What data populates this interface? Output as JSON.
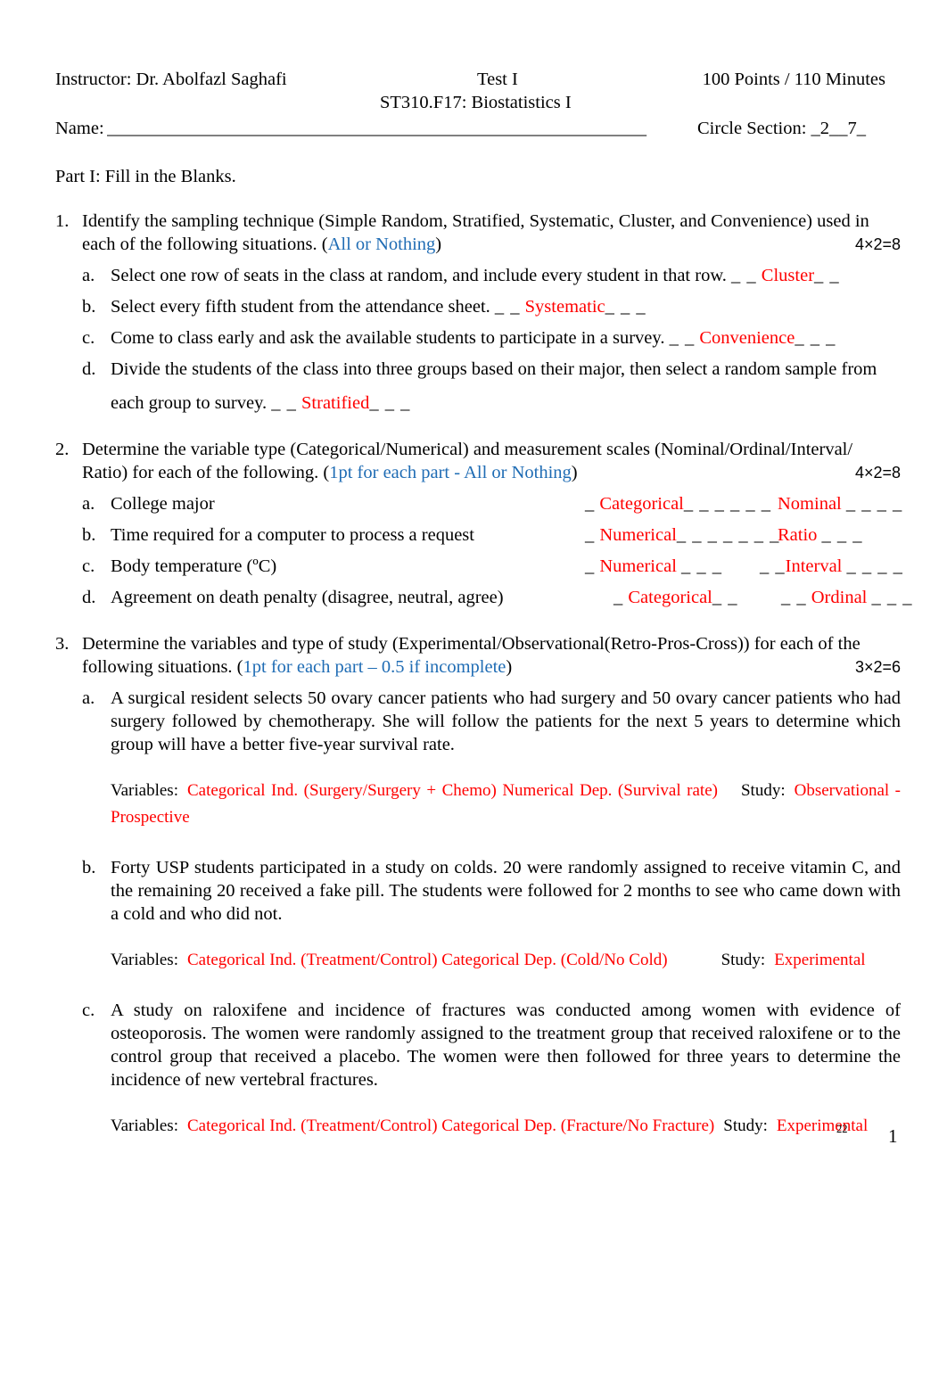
{
  "header": {
    "instructor": "Instructor: Dr. Abolfazl Saghafi",
    "test": "Test I",
    "points": "100 Points / 110 Minutes",
    "course": "ST310.F17: Biostatistics I",
    "name_label": "Name:",
    "name_line": "______________________________________________________________",
    "section": "Circle Section: _2__7_"
  },
  "part": {
    "title": "Part I: Fill in the Blanks."
  },
  "questions": [
    {
      "number": "1.",
      "stem_a": "Identify the sampling technique (Simple Random, Stratified, Systematic, Cluster, and Convenience) used in",
      "stem_b": "each of the following situations. (",
      "stem_blue": "All or Nothing",
      "stem_c": ")",
      "points": "4×2=8",
      "items": [
        {
          "label": "a.",
          "text": "Select one row of seats in the class at random, and include every student in that row.",
          "pre_blank": "_ _",
          "answer": "Cluster",
          "post_blank": "_ _"
        },
        {
          "label": "b.",
          "text": "Select every fifth student from the attendance sheet.",
          "pre_blank": "_ _",
          "answer": "Systematic",
          "post_blank": "_ _ _"
        },
        {
          "label": "c.",
          "text": "Come to class early and ask the available students to participate in a survey.",
          "pre_blank": "_ _",
          "answer": "Convenience",
          "post_blank": "_ _ _"
        },
        {
          "label": "d.",
          "text_line1": "Divide the students of the class into three groups based on their major, then select a random sample from",
          "text_line2": "each group to survey.",
          "pre_blank": "_ _",
          "answer": "Stratified",
          "post_blank": "_ _ _"
        }
      ]
    },
    {
      "number": "2.",
      "stem_a": "Determine the variable type (Categorical/Numerical) and measurement scales (Nominal/Ordinal/Interval/",
      "stem_b": "Ratio) for each of the following. (",
      "stem_blue": "1pt for each part - All or Nothing",
      "stem_c": ")",
      "points": "4×2=8",
      "items": [
        {
          "label": "a.",
          "text": "College major",
          "col1_pre": "_",
          "col1_answer": "Categorical",
          "col1_post": "_ _ _ _ _ _",
          "col2_pre": "",
          "col2_answer": "Nominal",
          "col2_post": "_ _ _ _"
        },
        {
          "label": "b.",
          "text": "Time required for a computer to process a request",
          "col1_pre": "_",
          "col1_answer": "Numerical",
          "col1_post": "_ _ _ _ _ _ _",
          "col2_pre": "",
          "col2_answer": "Ratio",
          "col2_post": "_ _ _"
        },
        {
          "label": "c.",
          "text": "Body temperature (ºC)",
          "col1_pre": "_",
          "col1_answer": "Numerical",
          "col1_post": "_ _ _",
          "col2_pre": "_ _",
          "col2_answer": "Interval",
          "col2_post": "_ _ _ _"
        },
        {
          "label": "d.",
          "text": "Agreement on death penalty (disagree, neutral, agree)",
          "col1_pre": "_",
          "col1_answer": "Categorical",
          "col1_post": "_ _",
          "col2_pre": "_ _",
          "col2_answer": "Ordinal",
          "col2_post": "_ _ _"
        }
      ]
    },
    {
      "number": "3.",
      "stem_a": "Determine the variables and type of study (Experimental/Observational(Retro-Pros-Cross)) for each of the",
      "stem_b": "following situations. (",
      "stem_blue": "1pt for each part – 0.5 if incomplete",
      "stem_c": ")",
      "points": "3×2=6",
      "items": [
        {
          "label": "a.",
          "paragraph": "A surgical resident selects 50 ovary cancer patients who had surgery and 50 ovary cancer patients who had surgery followed by chemotherapy. She will follow the patients for the next 5 years to determine which group will have a better five-year survival rate.",
          "variables_label": "Variables:",
          "variables_answer": "Categorical Ind. (Surgery/Surgery + Chemo) Numerical Dep. (Survival rate)",
          "study_label": "Study:",
          "study_answer": "Observational - Prospective"
        },
        {
          "label": "b.",
          "paragraph": "Forty USP students participated in a study on colds. 20 were randomly assigned to receive vitamin C, and the remaining 20 received a fake pill. The students were followed for 2 months to see who came down with a cold and who did not.",
          "variables_label": "Variables:",
          "variables_answer": "Categorical Ind. (Treatment/Control) Categorical Dep. (Cold/No Cold)",
          "study_label": "Study:",
          "study_answer": "Experimental"
        },
        {
          "label": "c.",
          "paragraph": "A study on raloxifene and incidence of fractures was conducted among women with evidence of osteoporosis. The women were randomly assigned to the treatment group that received raloxifene or to the control group that received a placebo. The women were then followed for three years to determine the incidence of new vertebral fractures.",
          "variables_label": "Variables:",
          "variables_answer": "Categorical Ind. (Treatment/Control) Categorical Dep. (Fracture/No Fracture)",
          "study_label": "Study:",
          "study_answer": "Experimental"
        }
      ]
    }
  ],
  "footer": {
    "note": "22",
    "page_number": "1"
  },
  "colors": {
    "answer_red": "#ff0000",
    "hint_blue": "#1f6cb4",
    "text_black": "#000000"
  }
}
